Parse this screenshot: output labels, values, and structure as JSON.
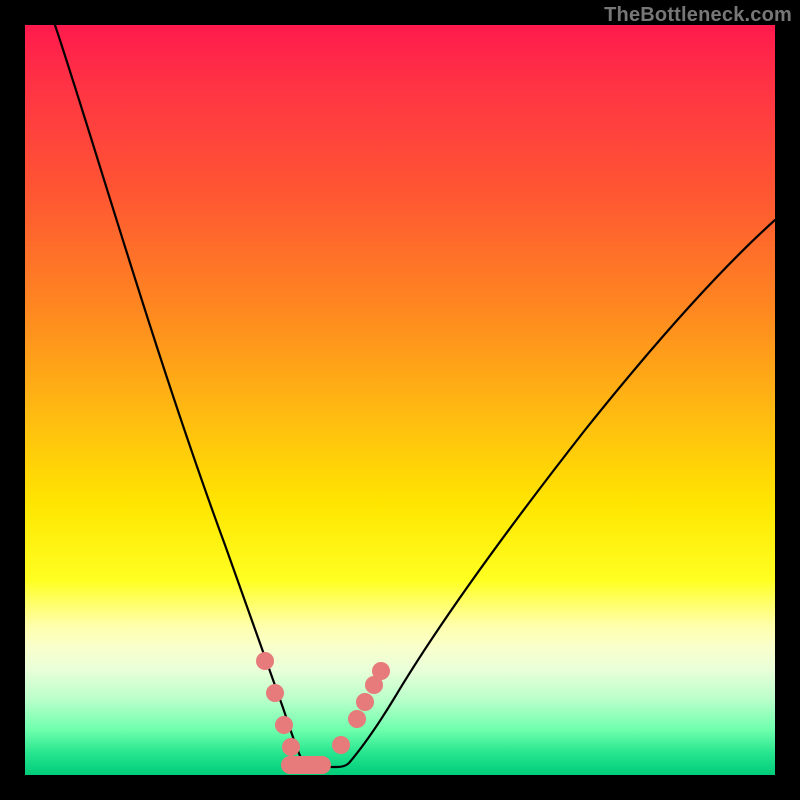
{
  "watermark": "TheBottleneck.com",
  "colors": {
    "frame": "#000000",
    "curve": "#000000",
    "marker": "#e77a7a",
    "gradient_stops": [
      "#ff1a4d",
      "#ff3344",
      "#ff5533",
      "#ff8820",
      "#ffbb11",
      "#ffe600",
      "#ffff22",
      "#ffffaa",
      "#f9ffcc",
      "#e9ffd9",
      "#b8ffc9",
      "#6effad",
      "#28e68f",
      "#00cc7a"
    ]
  },
  "chart_data": {
    "type": "line",
    "title": "",
    "xlabel": "",
    "ylabel": "",
    "xlim": [
      0,
      100
    ],
    "ylim": [
      0,
      100
    ],
    "grid": false,
    "background": "rainbow-gradient",
    "series": [
      {
        "name": "bottleneck-curve",
        "x": [
          4,
          8,
          12,
          16,
          20,
          24,
          28,
          30,
          32,
          34,
          35,
          36,
          37,
          38,
          40,
          42,
          46,
          52,
          60,
          70,
          82,
          95,
          100
        ],
        "y": [
          100,
          88,
          76,
          64,
          52,
          40,
          26,
          18,
          11,
          5,
          2,
          0.6,
          0.6,
          2,
          5,
          9,
          17,
          28,
          40,
          52,
          62,
          71,
          74
        ]
      }
    ],
    "markers": [
      {
        "name": "left-dot-1",
        "x": 30.0,
        "y": 18.0
      },
      {
        "name": "left-dot-2",
        "x": 31.5,
        "y": 13.0
      },
      {
        "name": "flat-left",
        "x": 33.5,
        "y": 3.0
      },
      {
        "name": "flat-mid",
        "x": 36.0,
        "y": 0.6
      },
      {
        "name": "flat-right",
        "x": 38.5,
        "y": 3.0
      },
      {
        "name": "right-dot-1",
        "x": 40.0,
        "y": 6.0
      },
      {
        "name": "right-dot-2",
        "x": 41.5,
        "y": 9.0
      },
      {
        "name": "right-dot-3",
        "x": 43.0,
        "y": 12.0
      },
      {
        "name": "right-dot-4",
        "x": 44.5,
        "y": 15.0
      }
    ],
    "flat_segment": {
      "x_start": 33.5,
      "x_end": 38.5,
      "y": 1.5
    },
    "notes": "V-shaped bottleneck curve. Minimum (optimal / 0% bottleneck) around x≈36. Values estimated from pixel positions; image has no numeric axes."
  }
}
